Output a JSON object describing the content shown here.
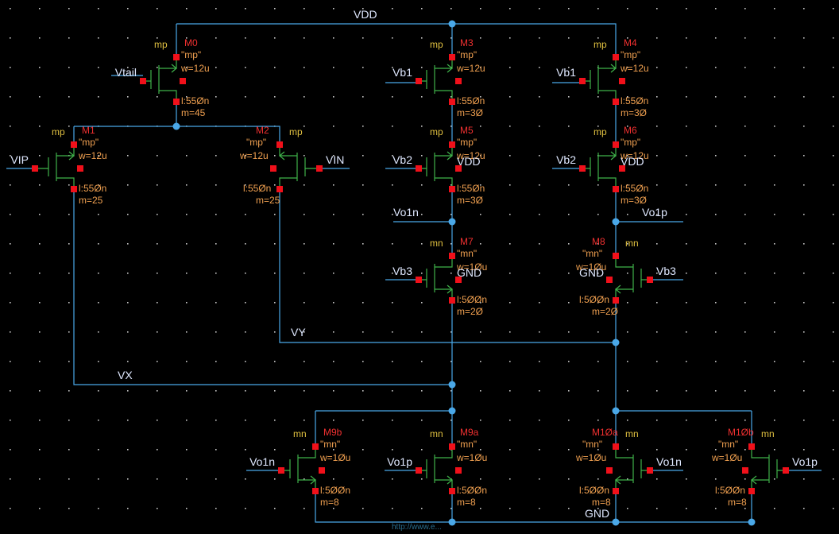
{
  "schematic": {
    "rails": {
      "vdd": "VDD",
      "gnd": "GND"
    },
    "internal_nets": {
      "vx": "VX",
      "vy": "VY"
    },
    "watermark": "http://www.e..."
  },
  "devices": [
    {
      "name": "M0",
      "model": "mp",
      "type": "\"mp\"",
      "w": "w=12u",
      "l": "l:55Øn",
      "m": "m=45",
      "gate": "Vtail"
    },
    {
      "name": "M1",
      "model": "mp",
      "type": "\"mp\"",
      "w": "w=12u",
      "l": "l:55Øn",
      "m": "m=25",
      "gate": "VIP"
    },
    {
      "name": "M2",
      "model": "mp",
      "type": "\"mp\"",
      "w": "w=12u",
      "l": "l:55Øn",
      "m": "m=25",
      "gate": "VIN"
    },
    {
      "name": "M3",
      "model": "mp",
      "type": "\"mp\"",
      "w": "w=12u",
      "l": "l:55Øn",
      "m": "m=3Ø",
      "gate": "Vb1"
    },
    {
      "name": "M4",
      "model": "mp",
      "type": "\"mp\"",
      "w": "w=12u",
      "l": "l:55Øn",
      "m": "m=3Ø",
      "gate": "Vb1"
    },
    {
      "name": "M5",
      "model": "mp",
      "type": "\"mp\"",
      "w": "w=12u",
      "l": "l:55Øn",
      "m": "m=3Ø",
      "gate": "Vb2",
      "bulk": "VDD"
    },
    {
      "name": "M6",
      "model": "mp",
      "type": "\"mp\"",
      "w": "w=12u",
      "l": "l:55Øn",
      "m": "m=3Ø",
      "gate": "Vb2",
      "bulk": "VDD"
    },
    {
      "name": "M7",
      "model": "mn",
      "type": "\"mn\"",
      "w": "w=1Øu",
      "l": "l:5ØØn",
      "m": "m=2Ø",
      "gate": "Vb3",
      "bulk": "GND",
      "drain_net": "Vo1n"
    },
    {
      "name": "M8",
      "model": "mn",
      "type": "\"mn\"",
      "w": "w=1Øu",
      "l": "l:5ØØn",
      "m": "m=2Ø",
      "gate": "Vb3",
      "bulk": "GND",
      "drain_net": "Vo1p"
    },
    {
      "name": "M9b",
      "model": "mn",
      "type": "\"mn\"",
      "w": "w=1Øu",
      "l": "l:5ØØn",
      "m": "m=8",
      "gate": "Vo1n"
    },
    {
      "name": "M9a",
      "model": "mn",
      "type": "\"mn\"",
      "w": "w=1Øu",
      "l": "l:5ØØn",
      "m": "m=8",
      "gate": "Vo1p"
    },
    {
      "name": "M1Øa",
      "model": "mn",
      "type": "\"mn\"",
      "w": "w=1Øu",
      "l": "l:5ØØn",
      "m": "m=8",
      "gate": "Vo1n"
    },
    {
      "name": "M1Øb",
      "model": "mn",
      "type": "\"mn\"",
      "w": "w=1Øu",
      "l": "l:5ØØn",
      "m": "m=8",
      "gate": "Vo1p"
    }
  ]
}
